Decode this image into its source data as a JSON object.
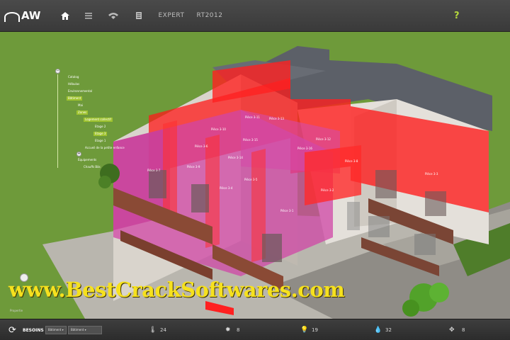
{
  "app": {
    "logo_text": "AW"
  },
  "topbar": {
    "expert_label": "EXPERT",
    "rt_label": "RT2012",
    "help_label": "?"
  },
  "tree": {
    "items": [
      {
        "label": "Catalog",
        "selected": false
      },
      {
        "label": "Hébulas",
        "selected": false
      },
      {
        "label": "Environnemental",
        "selected": false
      },
      {
        "label": "Bâtiment",
        "selected": true
      },
      {
        "label": "Mai",
        "selected": false
      },
      {
        "label": "Zones",
        "selected": true
      },
      {
        "label": "Logement collectif",
        "selected": true
      },
      {
        "label": "Etage 2",
        "selected": false
      },
      {
        "label": "Etage 3",
        "selected": true
      },
      {
        "label": "Etage 1",
        "selected": false
      },
      {
        "label": "Accueil de la petite enfance",
        "selected": false
      },
      {
        "label": "Équipements",
        "selected": false
      },
      {
        "label": "Chauffs Bâs",
        "selected": false
      }
    ]
  },
  "rooms": [
    "Pièce 3-11",
    "Pièce 3-13",
    "Pièce 3-10",
    "Pièce 3-15",
    "Pièce 3-12",
    "Pièce 3-16",
    "Pièce 3-8",
    "Pièce 3-6",
    "Pièce 3-14",
    "Pièce 3-9",
    "Pièce 3-7",
    "Pièce 3-5",
    "Pièce 3-4",
    "Pièce 3-3",
    "Pièce 3-2",
    "Pièce 3-1"
  ],
  "watermark": "www.BestCrackSoftwares.com",
  "propertie_label": "Propertie",
  "bottombar": {
    "besoins_label": "BESOINS",
    "select1": "Bâtiment",
    "select2": "Bâtiment",
    "metrics": [
      {
        "icon": "thermometer-icon",
        "value": "24"
      },
      {
        "icon": "sun-icon",
        "value": "8"
      },
      {
        "icon": "bulb-icon",
        "value": "19"
      },
      {
        "icon": "drop-icon",
        "value": "32"
      },
      {
        "icon": "fan-icon",
        "value": "8"
      }
    ]
  },
  "colors": {
    "grass": "#6e9a3a",
    "roof": "#5a5e66",
    "zone_red": "#ff1a1a",
    "zone_magenta": "#d0409a",
    "accent": "#b6d93d"
  }
}
